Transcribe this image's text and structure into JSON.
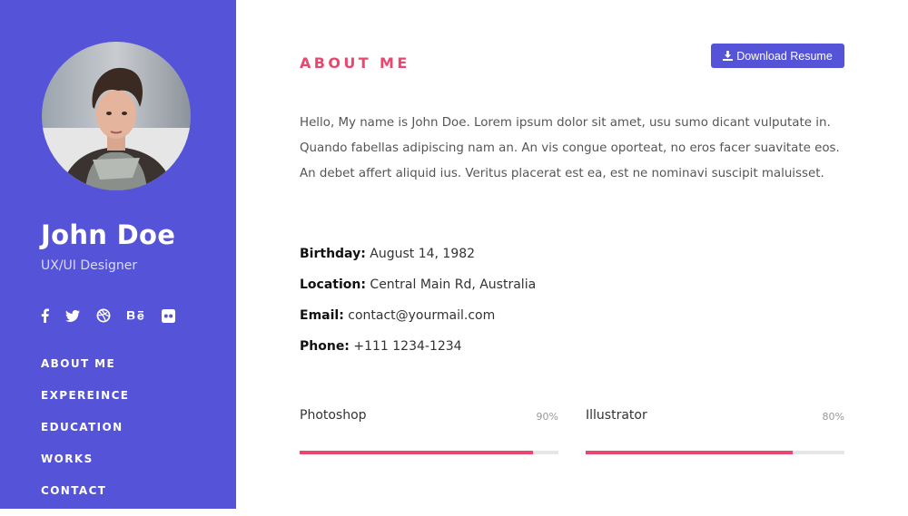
{
  "profile": {
    "name": "John Doe",
    "role": "UX/UI Designer"
  },
  "socials": [
    {
      "icon": "facebook-icon"
    },
    {
      "icon": "twitter-icon"
    },
    {
      "icon": "dribbble-icon"
    },
    {
      "icon": "behance-icon"
    },
    {
      "icon": "flickr-icon"
    }
  ],
  "nav": {
    "about": "ABOUT ME",
    "experience": "EXPEREINCE",
    "education": "EDUCATION",
    "works": "WORKS",
    "contact": "CONTACT"
  },
  "about": {
    "title": "ABOUT ME",
    "download_label": "Download Resume",
    "text": "Hello, My name is John Doe. Lorem ipsum dolor sit amet, usu sumo dicant vulputate in. Quando fabellas adipiscing nam an. An vis congue oporteat, no eros facer suavitate eos. An debet affert aliquid ius. Veritus placerat est ea, est ne nominavi suscipit maluisset.",
    "info": {
      "birthday_label": "Birthday:",
      "birthday": "August 14, 1982",
      "location_label": "Location:",
      "location": "Central Main Rd, Australia",
      "email_label": "Email:",
      "email": "contact@yourmail.com",
      "phone_label": "Phone:",
      "phone": "+111 1234-1234"
    }
  },
  "skills": [
    {
      "name": "Photoshop",
      "percent_label": "90%",
      "level": 0.9
    },
    {
      "name": "Illustrator",
      "percent_label": "80%",
      "level": 0.8
    }
  ],
  "colors": {
    "sidebar": "#5554d8",
    "accent": "#e8476f",
    "button": "#5554d8"
  }
}
